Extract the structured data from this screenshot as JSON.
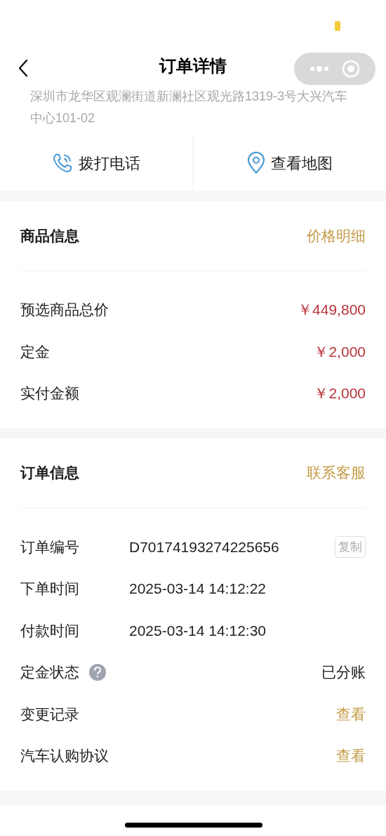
{
  "nav": {
    "title": "订单详情"
  },
  "address": "深圳市龙华区观澜街道新澜社区观光路1319-3号大兴汽车中心101-02",
  "actions": [
    {
      "kind": "phone",
      "label": "拨打电话"
    },
    {
      "kind": "map",
      "label": "查看地图"
    }
  ],
  "sections": [
    {
      "title": "商品信息",
      "action": "价格明细",
      "rows": [
        {
          "kind": "price",
          "label": "预选商品总价",
          "value": "￥449,800"
        },
        {
          "kind": "price",
          "label": "定金",
          "value": "￥2,000"
        },
        {
          "kind": "price",
          "label": "实付金额",
          "value": "￥2,000"
        }
      ]
    },
    {
      "title": "订单信息",
      "action": "联系客服",
      "rows": [
        {
          "kind": "copy",
          "label": "订单编号",
          "value": "D70174193274225656",
          "button": "复制"
        },
        {
          "kind": "text",
          "label": "下单时间",
          "value": "2025-03-14 14:12:22"
        },
        {
          "kind": "text",
          "label": "付款时间",
          "value": "2025-03-14 14:12:30"
        },
        {
          "kind": "status",
          "label": "定金状态",
          "value": "已分账"
        },
        {
          "kind": "link",
          "label": "变更记录",
          "value": "查看"
        },
        {
          "kind": "link",
          "label": "汽车认购协议",
          "value": "查看"
        }
      ]
    }
  ]
}
